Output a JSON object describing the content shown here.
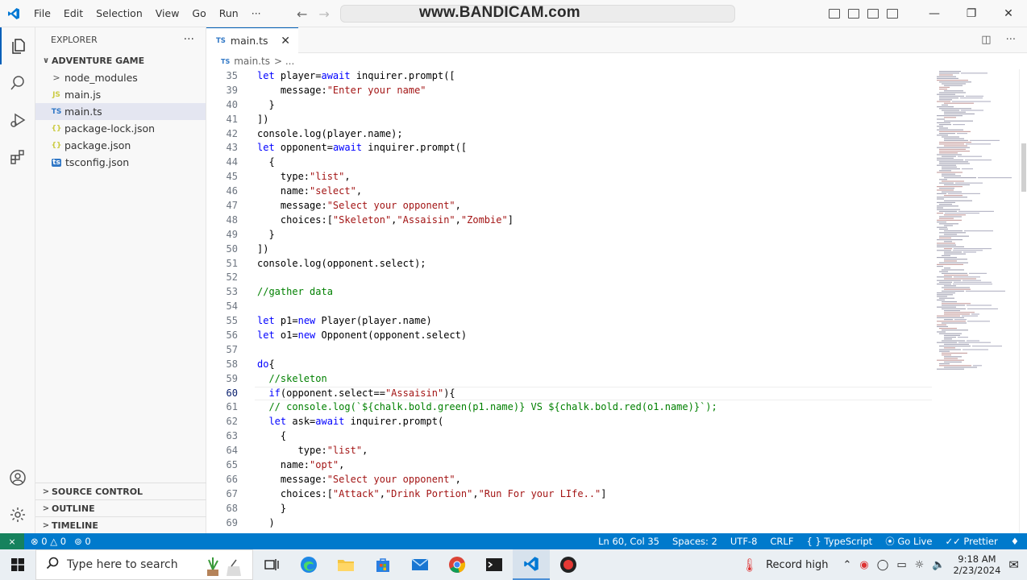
{
  "menu": [
    "File",
    "Edit",
    "Selection",
    "View",
    "Go",
    "Run",
    "···"
  ],
  "watermark": "www.BANDICAM.com",
  "explorer": {
    "title": "EXPLORER",
    "more": "···",
    "folder": "ADVENTURE GAME",
    "items": [
      {
        "icon": ">",
        "label": "node_modules"
      },
      {
        "icon": "JS",
        "label": "main.js"
      },
      {
        "icon": "TS",
        "label": "main.ts"
      },
      {
        "icon": "{}",
        "label": "package-lock.json"
      },
      {
        "icon": "{}",
        "label": "package.json"
      },
      {
        "icon": "ts",
        "label": "tsconfig.json"
      }
    ],
    "sections": [
      "SOURCE CONTROL",
      "OUTLINE",
      "TIMELINE"
    ]
  },
  "tab": {
    "icon": "TS",
    "label": "main.ts",
    "close": "✕"
  },
  "breadcrumb": {
    "icon": "TS",
    "file": "main.ts",
    "rest": "> ..."
  },
  "code": [
    {
      "n": "35",
      "t": "let player=await inquirer.prompt(["
    },
    {
      "n": "39",
      "t": "    message:\"Enter your name\""
    },
    {
      "n": "40",
      "t": "  }"
    },
    {
      "n": "41",
      "t": "])"
    },
    {
      "n": "42",
      "t": "console.log(player.name);"
    },
    {
      "n": "43",
      "t": "let opponent=await inquirer.prompt(["
    },
    {
      "n": "44",
      "t": "  {"
    },
    {
      "n": "45",
      "t": "    type:\"list\","
    },
    {
      "n": "46",
      "t": "    name:\"select\","
    },
    {
      "n": "47",
      "t": "    message:\"Select your opponent\","
    },
    {
      "n": "48",
      "t": "    choices:[\"Skeleton\",\"Assaisin\",\"Zombie\"]"
    },
    {
      "n": "49",
      "t": "  }"
    },
    {
      "n": "50",
      "t": "])"
    },
    {
      "n": "51",
      "t": "console.log(opponent.select);"
    },
    {
      "n": "52",
      "t": ""
    },
    {
      "n": "53",
      "t": "//gather data"
    },
    {
      "n": "54",
      "t": ""
    },
    {
      "n": "55",
      "t": "let p1=new Player(player.name)"
    },
    {
      "n": "56",
      "t": "let o1=new Opponent(opponent.select)"
    },
    {
      "n": "57",
      "t": ""
    },
    {
      "n": "58",
      "t": "do{"
    },
    {
      "n": "59",
      "t": "  //skeleton"
    },
    {
      "n": "60",
      "t": "  if(opponent.select==\"Assaisin\"){"
    },
    {
      "n": "61",
      "t": "  // console.log(`${chalk.bold.green(p1.name)} VS ${chalk.bold.red(o1.name)}`);"
    },
    {
      "n": "62",
      "t": "  let ask=await inquirer.prompt("
    },
    {
      "n": "63",
      "t": "    {"
    },
    {
      "n": "64",
      "t": "       type:\"list\","
    },
    {
      "n": "65",
      "t": "    name:\"opt\","
    },
    {
      "n": "66",
      "t": "    message:\"Select your opponent\","
    },
    {
      "n": "67",
      "t": "    choices:[\"Attack\",\"Drink Portion\",\"Run For your LIfe..\"]"
    },
    {
      "n": "68",
      "t": "    }"
    },
    {
      "n": "69",
      "t": "  )"
    }
  ],
  "current_line": "60",
  "status": {
    "errors": "0",
    "warnings": "0",
    "ports": "0",
    "position": "Ln 60, Col 35",
    "spaces": "Spaces: 2",
    "encoding": "UTF-8",
    "eol": "CRLF",
    "language": "TypeScript",
    "golive": "Go Live",
    "prettier": "Prettier"
  },
  "taskbar": {
    "search_placeholder": "Type here to search",
    "record": "Record high",
    "time": "9:18 AM",
    "date": "2/23/2024"
  },
  "colors": {
    "accent": "#005fb8",
    "statusbar": "#007acc",
    "keyword": "#0000ff",
    "string": "#a31515",
    "comment": "#008000"
  }
}
